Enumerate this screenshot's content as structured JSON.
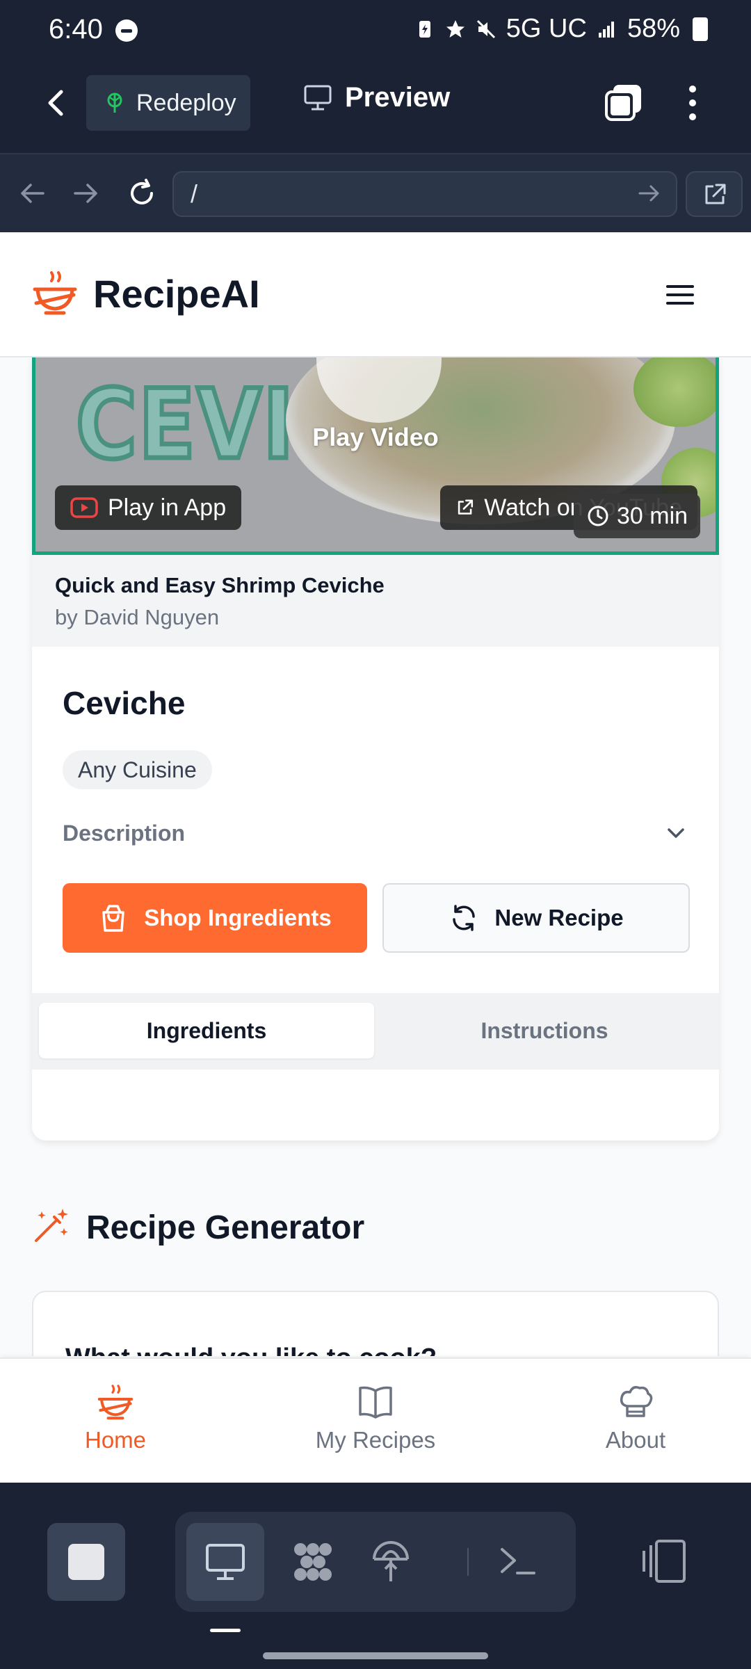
{
  "status_bar": {
    "time": "6:40",
    "network": "5G UC",
    "battery": "58%"
  },
  "app_bar": {
    "redeploy_label": "Redeploy",
    "preview_label": "Preview"
  },
  "url_bar": {
    "value": "/"
  },
  "site_header": {
    "brand": "RecipeAI"
  },
  "video": {
    "play_label": "Play Video",
    "play_in_app": "Play in App",
    "watch_youtube": "Watch on YouTube",
    "duration": "30 min",
    "title": "Quick and Easy Shrimp Ceviche",
    "author": "by David Nguyen"
  },
  "recipe": {
    "title": "Ceviche",
    "cuisine": "Any Cuisine",
    "description_label": "Description",
    "shop_button": "Shop Ingredients",
    "new_recipe_button": "New Recipe",
    "tabs": [
      {
        "label": "Ingredients",
        "active": true
      },
      {
        "label": "Instructions",
        "active": false
      }
    ]
  },
  "generator": {
    "title": "Recipe Generator",
    "question": "What would you like to cook?"
  },
  "bottom_nav": {
    "items": [
      {
        "label": "Home",
        "icon": "home-bowl-icon",
        "active": true
      },
      {
        "label": "My Recipes",
        "icon": "book-icon",
        "active": false
      },
      {
        "label": "About",
        "icon": "chef-hat-icon",
        "active": false
      }
    ]
  },
  "colors": {
    "accent": "#ff6a30",
    "nav_active": "#f15a24",
    "dark_chrome": "#1b2233",
    "video_border": "#14a37f"
  }
}
